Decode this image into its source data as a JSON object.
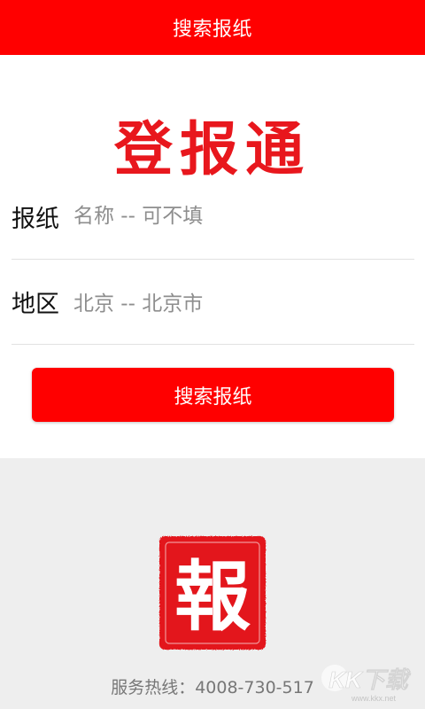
{
  "header": {
    "title": "搜索报纸",
    "background": "#ff0000"
  },
  "brand": {
    "name": "登报通",
    "color": "#e8171d"
  },
  "form": {
    "newspaper": {
      "label": "报纸",
      "placeholder": "名称 -- 可不填"
    },
    "region": {
      "label": "地区",
      "value": "北京 -- 北京市"
    },
    "submit_label": "搜索报纸"
  },
  "footer": {
    "seal_char": "報",
    "seal_icon": "newspaper-seal-logo",
    "hotline": "服务热线：4008-730-517"
  },
  "watermark": {
    "text": "KK下载",
    "url_text": "www.kkx.net"
  }
}
